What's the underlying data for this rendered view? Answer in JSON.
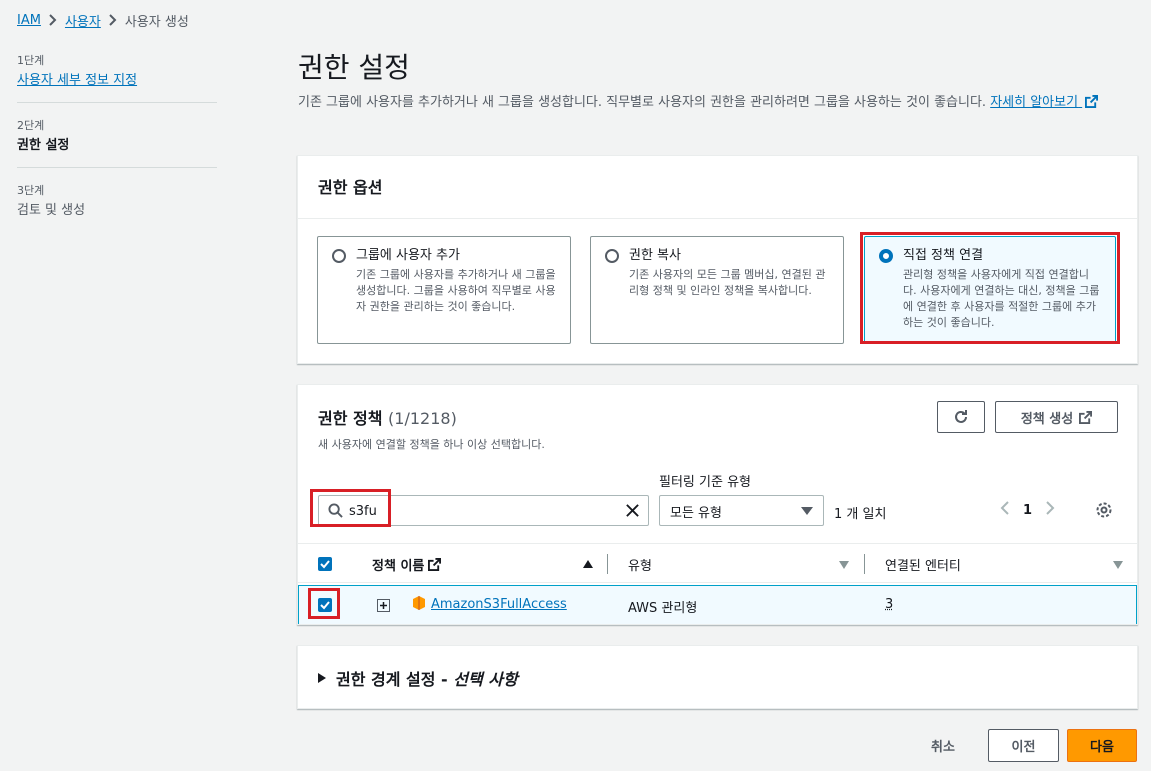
{
  "breadcrumb": {
    "items": [
      "IAM",
      "사용자",
      "사용자 생성"
    ]
  },
  "steps": [
    {
      "num": "1단계",
      "title": "사용자 세부 정보 지정"
    },
    {
      "num": "2단계",
      "title": "권한 설정"
    },
    {
      "num": "3단계",
      "title": "검토 및 생성"
    }
  ],
  "page": {
    "title": "권한 설정",
    "description": "기존 그룹에 사용자를 추가하거나 새 그룹을 생성합니다. 직무별로 사용자의 권한을 관리하려면 그룹을 사용하는 것이 좋습니다.",
    "learn_more": "자세히 알아보기"
  },
  "permission_options": {
    "title": "권한 옵션",
    "options": [
      {
        "title": "그룹에 사용자 추가",
        "description": "기존 그룹에 사용자를 추가하거나 새 그룹을 생성합니다. 그룹을 사용하여 직무별로 사용자 권한을 관리하는 것이 좋습니다.",
        "selected": false
      },
      {
        "title": "권한 복사",
        "description": "기존 사용자의 모든 그룹 멤버십, 연결된 관리형 정책 및 인라인 정책을 복사합니다.",
        "selected": false
      },
      {
        "title": "직접 정책 연결",
        "description": "관리형 정책을 사용자에게 직접 연결합니다. 사용자에게 연결하는 대신, 정책을 그룹에 연결한 후 사용자를 적절한 그룹에 추가하는 것이 좋습니다.",
        "selected": true
      }
    ]
  },
  "policies": {
    "title": "권한 정책",
    "count": "(1/1218)",
    "description": "새 사용자에 연결할 정책을 하나 이상 선택합니다.",
    "create_policy_label": "정책 생성",
    "filter_type_label": "필터링 기준 유형",
    "search_value": "s3fu",
    "filter_type_value": "모든 유형",
    "match_count": "1 개 일치",
    "page": "1",
    "columns": {
      "name": "정책 이름",
      "type": "유형",
      "entities": "연결된 엔터티"
    },
    "rows": [
      {
        "name": "AmazonS3FullAccess",
        "type": "AWS 관리형",
        "entities": "3",
        "checked": true
      }
    ]
  },
  "boundary": {
    "title": "권한 경계 설정 - ",
    "optional": "선택 사항"
  },
  "footer": {
    "cancel": "취소",
    "previous": "이전",
    "next": "다음"
  },
  "colors": {
    "accent": "#0073bb",
    "primary_button": "#ff9900",
    "highlight": "#d81f26"
  }
}
